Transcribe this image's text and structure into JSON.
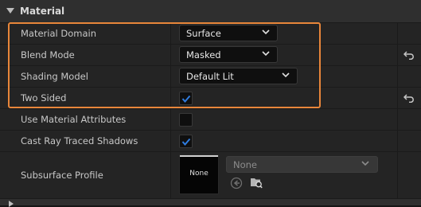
{
  "section": {
    "title": "Material"
  },
  "rows": {
    "material_domain": {
      "label": "Material Domain",
      "value": "Surface"
    },
    "blend_mode": {
      "label": "Blend Mode",
      "value": "Masked"
    },
    "shading_model": {
      "label": "Shading Model",
      "value": "Default Lit"
    },
    "two_sided": {
      "label": "Two Sided",
      "checked": true
    },
    "use_material_attributes": {
      "label": "Use Material Attributes",
      "checked": false
    },
    "cast_ray_traced_shadows": {
      "label": "Cast Ray Traced Shadows",
      "checked": true
    },
    "subsurface_profile": {
      "label": "Subsurface Profile",
      "thumbnail_label": "None",
      "value": "None"
    }
  },
  "colors": {
    "highlight": "#e8863a",
    "checkbox_check": "#2f7de1"
  },
  "icons": {
    "collapse": "triangle-down-icon",
    "reset": "reset-arrow-icon",
    "use_selected": "left-arrow-circle-icon",
    "browse": "folder-search-icon"
  }
}
